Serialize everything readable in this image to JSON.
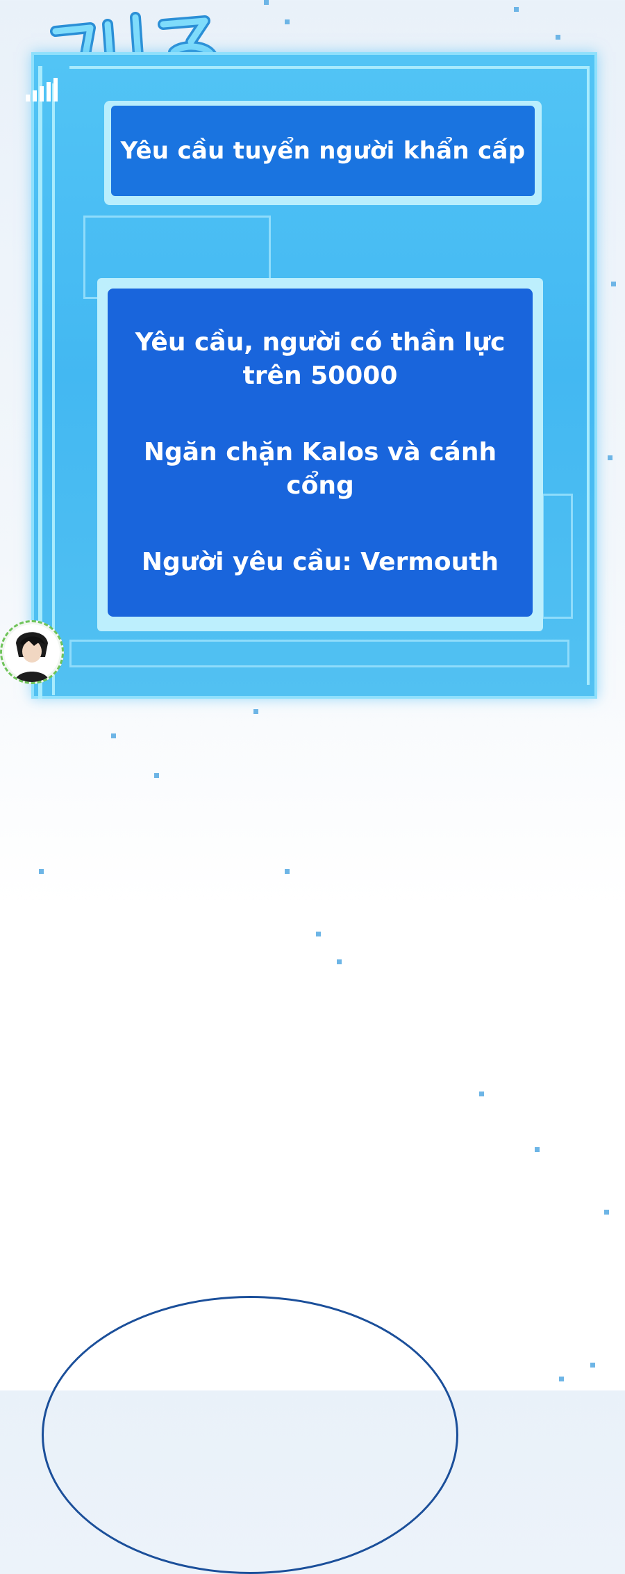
{
  "sound_effect": {
    "text": "띠링",
    "color": "#5fc8f5"
  },
  "notice": {
    "title": "Yêu cầu tuyển người khẩn cấp",
    "lines": [
      "Yêu cầu, người có thần lực",
      "trên 50000",
      "Ngăn chặn Kalos và cánh cổng",
      "Người yêu cầu: Vermouth"
    ]
  },
  "colors": {
    "panel": "#43b8f2",
    "title_box": "#1a74e0",
    "content_box": "#1965dc",
    "text": "#ffffff"
  },
  "icons": [
    "avatar-icon",
    "signal-bars-icon"
  ]
}
